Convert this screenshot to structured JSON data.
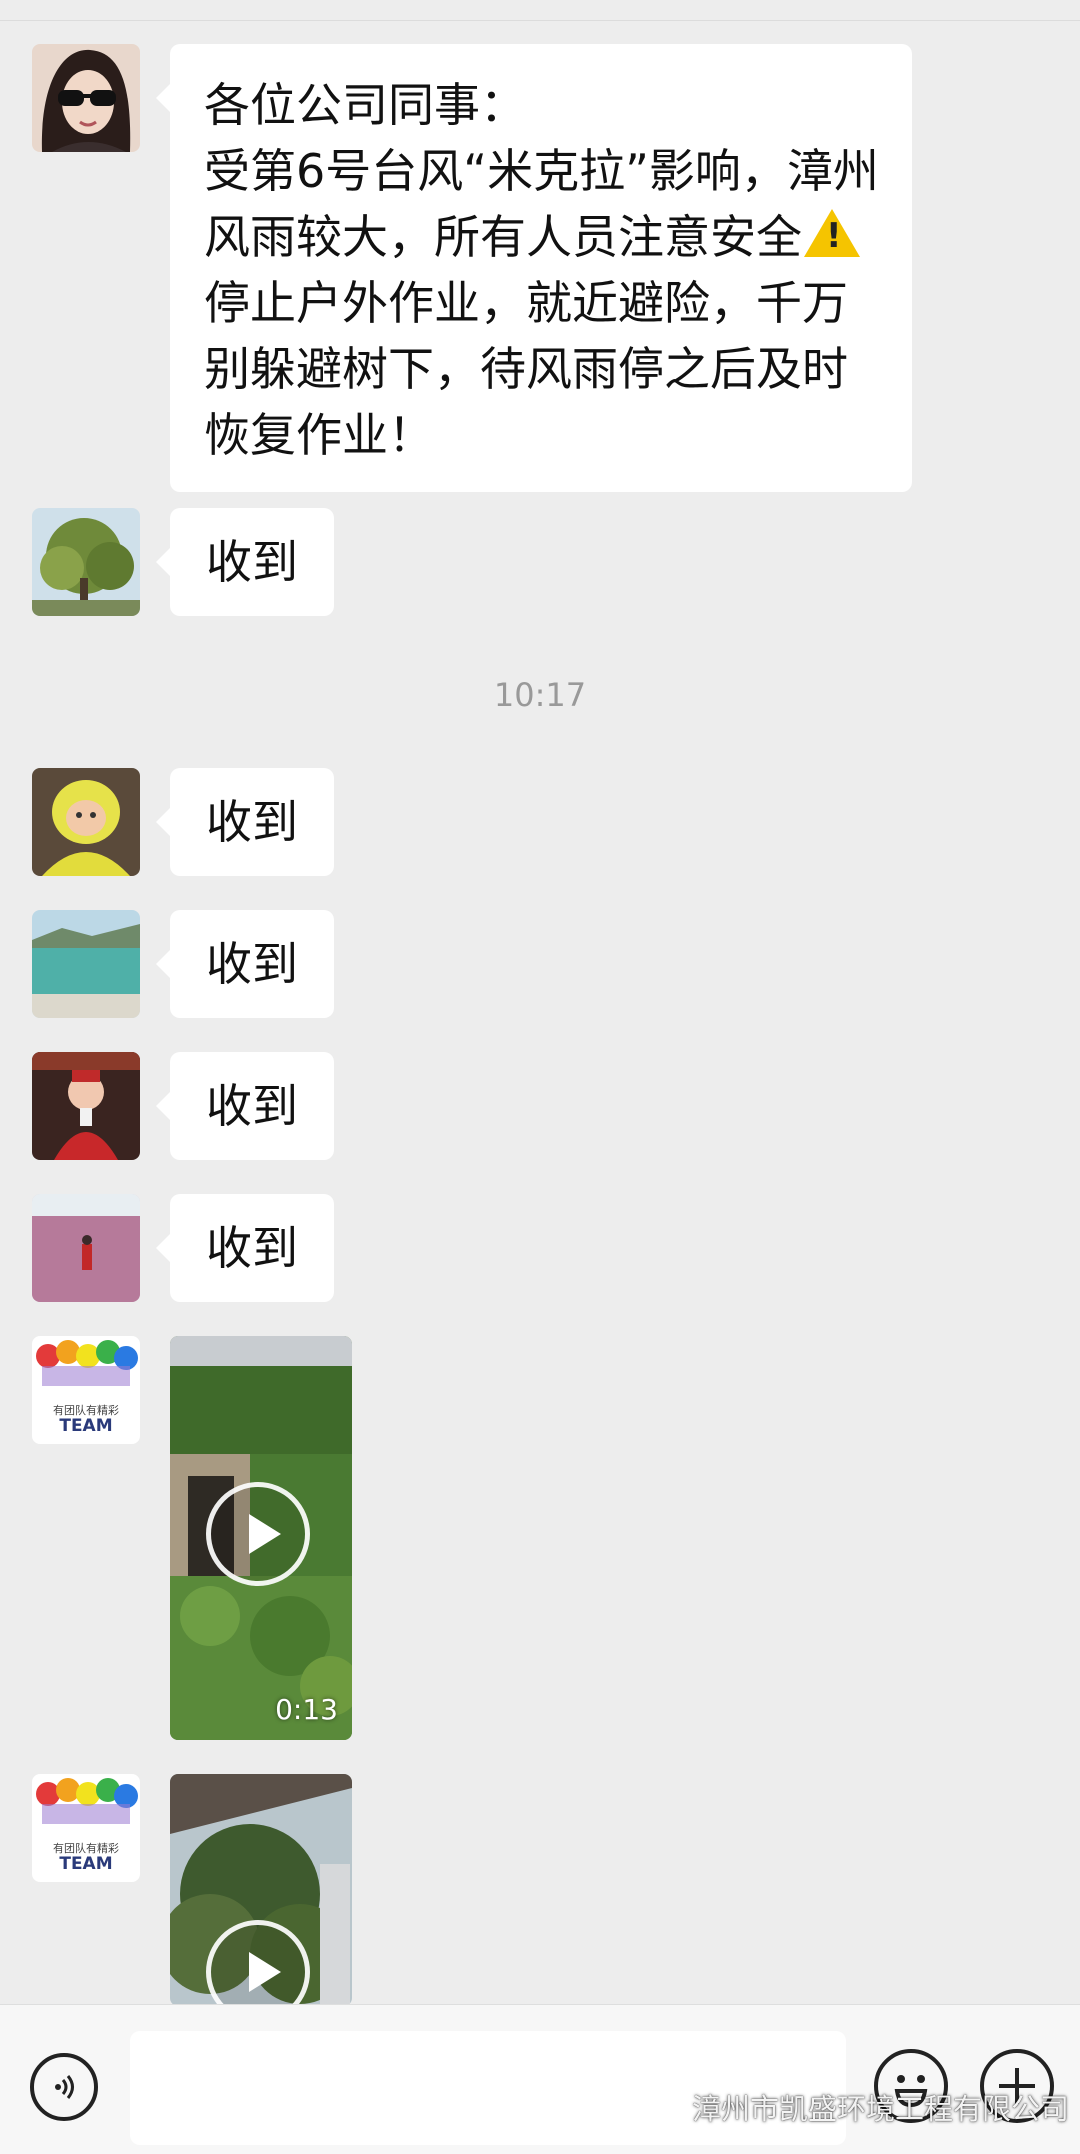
{
  "chat": {
    "messages": [
      {
        "type": "text",
        "lines": [
          "各位公司同事：",
          "受第6号台风“米克拉”影响，漳州",
          "风雨较大，所有人员注意安全",
          "停止户外作业，就近避险，千万",
          "别躲避树下，待风雨停之后及时",
          "恢复作业！"
        ],
        "emoji": "!"
      },
      {
        "type": "text",
        "text": "收到"
      },
      {
        "type": "time",
        "text": "10:17"
      },
      {
        "type": "text",
        "text": "收到"
      },
      {
        "type": "text",
        "text": "收到"
      },
      {
        "type": "text",
        "text": "收到"
      },
      {
        "type": "text",
        "text": "收到"
      },
      {
        "type": "video",
        "duration": "0:13"
      },
      {
        "type": "video"
      }
    ],
    "team_avatar_text": "TEAM",
    "team_avatar_subtext": "有团队有精彩"
  },
  "input_bar": {
    "voice_icon": "voice-icon",
    "emoji_icon": "emoji-icon",
    "plus_icon": "plus-icon",
    "input_value": ""
  },
  "watermark": {
    "text": "漳州市凯盛环境工程有限公司",
    "icon": "wechat-icon"
  },
  "colors": {
    "background": "#ededed",
    "bubble": "#ffffff",
    "time_text": "#999999",
    "warning": "#f5c400"
  }
}
